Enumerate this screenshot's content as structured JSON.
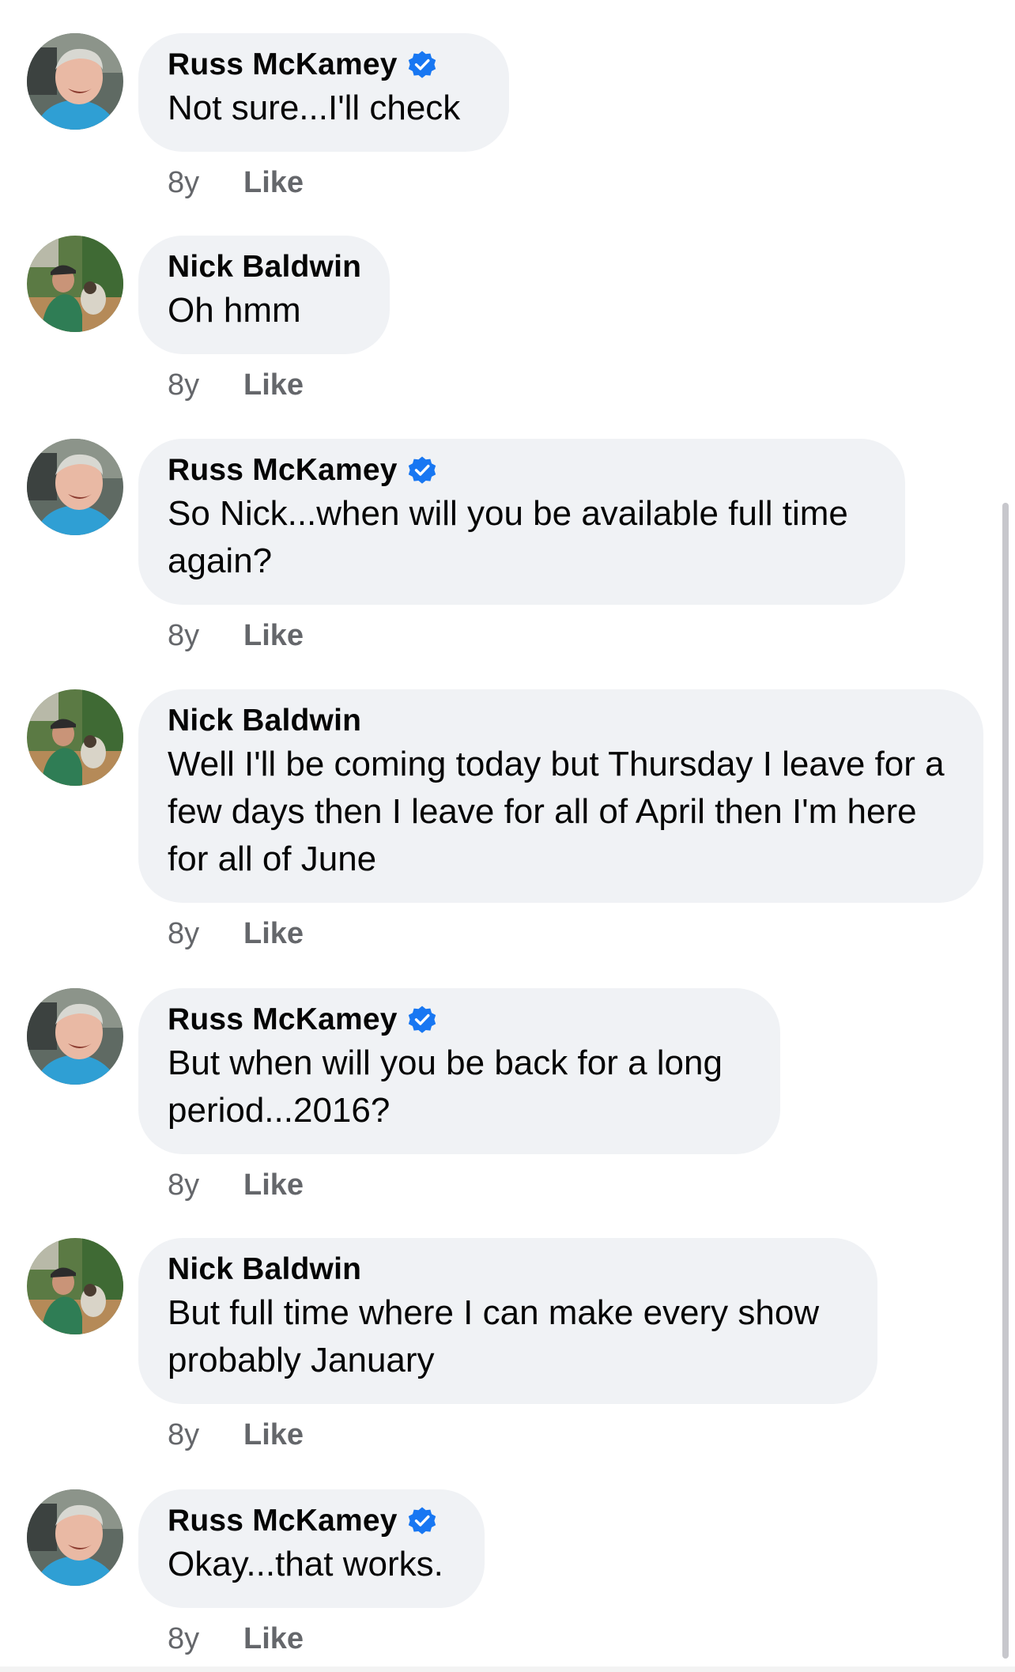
{
  "colors": {
    "bubble_bg": "#f0f2f5",
    "meta_text": "#65676b",
    "verified_badge": "#1877f2",
    "page_bg": "#ffffff"
  },
  "icons": {
    "verified": "verified-badge-icon"
  },
  "comments": [
    {
      "author": "Russ McKamey",
      "verified": true,
      "text": "Not sure...I'll check",
      "age": "8y",
      "like_label": "Like"
    },
    {
      "author": "Nick Baldwin",
      "verified": false,
      "text": "Oh hmm",
      "age": "8y",
      "like_label": "Like"
    },
    {
      "author": "Russ McKamey",
      "verified": true,
      "text": "So Nick...when will you be available full time again?",
      "age": "8y",
      "like_label": "Like"
    },
    {
      "author": "Nick Baldwin",
      "verified": false,
      "text": "Well I'll be coming today but Thursday I leave for a few days then I leave for all of April then I'm here for all of June",
      "age": "8y",
      "like_label": "Like"
    },
    {
      "author": "Russ McKamey",
      "verified": true,
      "text": "But when will you be back for a long period...2016?",
      "age": "8y",
      "like_label": "Like"
    },
    {
      "author": "Nick Baldwin",
      "verified": false,
      "text": "But full time where I can make every show probably January",
      "age": "8y",
      "like_label": "Like"
    },
    {
      "author": "Russ McKamey",
      "verified": true,
      "text": "Okay...that works.",
      "age": "8y",
      "like_label": "Like"
    }
  ]
}
